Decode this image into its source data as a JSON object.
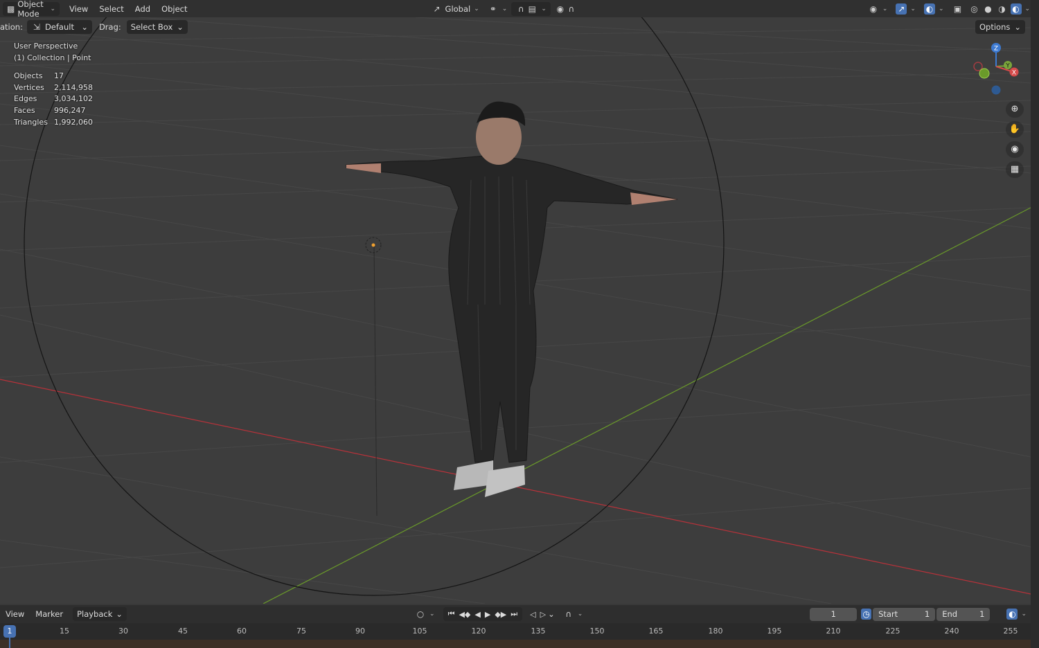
{
  "header": {
    "mode_label": "Object Mode",
    "menus": [
      "View",
      "Select",
      "Add",
      "Object"
    ],
    "transform_orientation": "Global"
  },
  "toolbar": {
    "orientation_label": "ation:",
    "orientation_value": "Default",
    "drag_label": "Drag:",
    "drag_value": "Select Box",
    "options_label": "Options"
  },
  "overlay": {
    "view_name": "User Perspective",
    "collection": "(1) Collection | Point",
    "stats": [
      {
        "label": "Objects",
        "value": "17"
      },
      {
        "label": "Vertices",
        "value": "2,114,958"
      },
      {
        "label": "Edges",
        "value": "3,034,102"
      },
      {
        "label": "Faces",
        "value": "996,247"
      },
      {
        "label": "Triangles",
        "value": "1,992,060"
      }
    ]
  },
  "gizmo": {
    "z": "Z",
    "y": "Y",
    "x": "X"
  },
  "timeline": {
    "menus": [
      "View",
      "Marker"
    ],
    "playback_label": "Playback",
    "current_frame": "1",
    "start_label": "Start",
    "start_value": "1",
    "end_label": "End",
    "end_value": "1",
    "cursor_frame": "1",
    "ruler_ticks": [
      "15",
      "30",
      "45",
      "60",
      "75",
      "90",
      "105",
      "120",
      "135",
      "150",
      "165",
      "180",
      "195",
      "210",
      "225",
      "240",
      "255"
    ]
  },
  "colors": {
    "x_axis": "#b8323a",
    "y_axis": "#6a9a2a",
    "accent": "#4772b3"
  }
}
